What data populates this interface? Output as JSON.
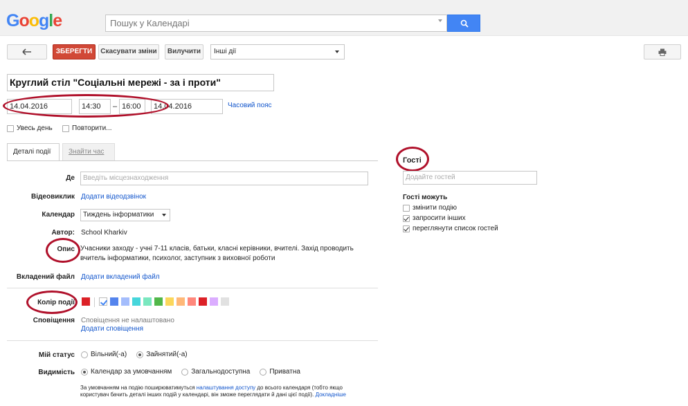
{
  "header": {
    "logo": "Google",
    "search_placeholder": "Пошук у Календарі"
  },
  "toolbar": {
    "save_label": "ЗБЕРЕГТИ",
    "cancel_label": "Скасувати зміни",
    "delete_label": "Вилучити",
    "other_actions": "Інші дії"
  },
  "event": {
    "title": "Круглий стіл \"Соціальні мережі - за і проти\"",
    "start_date": "14.04.2016",
    "start_time": "14:30",
    "end_time": "16:00",
    "end_date": "14.04.2016",
    "timezone_link": "Часовий пояс",
    "all_day_label": "Увесь день",
    "repeat_label": "Повторити..."
  },
  "tabs": {
    "details": "Деталі події",
    "find_time": "Знайти час"
  },
  "details": {
    "where_label": "Де",
    "where_placeholder": "Введіть місцезнаходження",
    "video_label": "Відеовиклик",
    "video_link": "Додати відеодзвінок",
    "calendar_label": "Календар",
    "calendar_value": "Тиждень інформатики",
    "author_label": "Автор:",
    "author_value": "School Kharkiv",
    "desc_label": "Опис",
    "desc_value": "Учасники заходу - учні 7-11 класів, батьки, класні керівники, вчителі. Захід проводить вчитель інформатики, психолог, заступник з виховної роботи",
    "attachment_label": "Вкладений файл",
    "attachment_link": "Додати вкладений файл",
    "color_label": "Колір події",
    "notif_label": "Сповіщення",
    "notif_value": "Сповіщення не налаштовано",
    "notif_link": "Додати сповіщення",
    "status_label": "Мій статус",
    "status_free": "Вільний(-а)",
    "status_busy": "Зайнятий(-а)",
    "visibility_label": "Видимість",
    "vis_default": "Календар за умовчанням",
    "vis_public": "Загальнодоступна",
    "vis_private": "Приватна",
    "note_part1": "За умовчанням на подію поширюватимуться ",
    "note_link": "налаштування доступу",
    "note_part2": " до всього календаря (тобто якщо користувач бачить деталі інших подій у календарі, він зможе переглядати й дані цієї події). ",
    "note_more": "Докладніше"
  },
  "colors": {
    "swatches": [
      "#dc2127",
      "#ffffff",
      "#5484ed",
      "#a4bdfc",
      "#46d6db",
      "#7ae7bf",
      "#51b749",
      "#fbd75b",
      "#ffb878",
      "#ff887c",
      "#dc2127",
      "#dbadff",
      "#e1e1e1"
    ],
    "annotation": "#b0112b"
  },
  "guests": {
    "title": "Гості",
    "placeholder": "Додайте гостей",
    "can_title": "Гості можуть",
    "perm_modify": "змінити подію",
    "perm_invite": "запросити інших",
    "perm_see": "переглянути список гостей"
  }
}
